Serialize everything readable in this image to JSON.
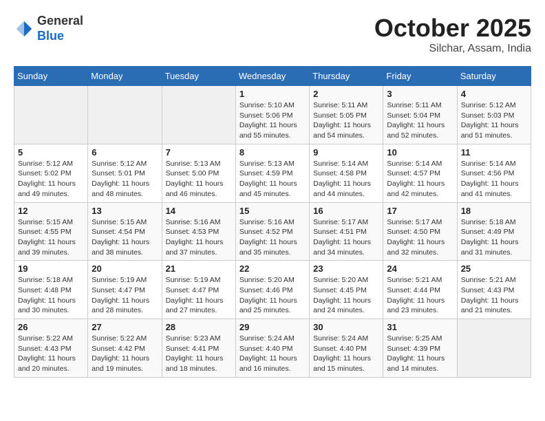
{
  "header": {
    "logo_general": "General",
    "logo_blue": "Blue",
    "month_title": "October 2025",
    "subtitle": "Silchar, Assam, India"
  },
  "weekdays": [
    "Sunday",
    "Monday",
    "Tuesday",
    "Wednesday",
    "Thursday",
    "Friday",
    "Saturday"
  ],
  "weeks": [
    [
      null,
      null,
      null,
      {
        "day": 1,
        "sunrise": "Sunrise: 5:10 AM",
        "sunset": "Sunset: 5:06 PM",
        "daylight": "Daylight: 11 hours and 55 minutes."
      },
      {
        "day": 2,
        "sunrise": "Sunrise: 5:11 AM",
        "sunset": "Sunset: 5:05 PM",
        "daylight": "Daylight: 11 hours and 54 minutes."
      },
      {
        "day": 3,
        "sunrise": "Sunrise: 5:11 AM",
        "sunset": "Sunset: 5:04 PM",
        "daylight": "Daylight: 11 hours and 52 minutes."
      },
      {
        "day": 4,
        "sunrise": "Sunrise: 5:12 AM",
        "sunset": "Sunset: 5:03 PM",
        "daylight": "Daylight: 11 hours and 51 minutes."
      }
    ],
    [
      {
        "day": 5,
        "sunrise": "Sunrise: 5:12 AM",
        "sunset": "Sunset: 5:02 PM",
        "daylight": "Daylight: 11 hours and 49 minutes."
      },
      {
        "day": 6,
        "sunrise": "Sunrise: 5:12 AM",
        "sunset": "Sunset: 5:01 PM",
        "daylight": "Daylight: 11 hours and 48 minutes."
      },
      {
        "day": 7,
        "sunrise": "Sunrise: 5:13 AM",
        "sunset": "Sunset: 5:00 PM",
        "daylight": "Daylight: 11 hours and 46 minutes."
      },
      {
        "day": 8,
        "sunrise": "Sunrise: 5:13 AM",
        "sunset": "Sunset: 4:59 PM",
        "daylight": "Daylight: 11 hours and 45 minutes."
      },
      {
        "day": 9,
        "sunrise": "Sunrise: 5:14 AM",
        "sunset": "Sunset: 4:58 PM",
        "daylight": "Daylight: 11 hours and 44 minutes."
      },
      {
        "day": 10,
        "sunrise": "Sunrise: 5:14 AM",
        "sunset": "Sunset: 4:57 PM",
        "daylight": "Daylight: 11 hours and 42 minutes."
      },
      {
        "day": 11,
        "sunrise": "Sunrise: 5:14 AM",
        "sunset": "Sunset: 4:56 PM",
        "daylight": "Daylight: 11 hours and 41 minutes."
      }
    ],
    [
      {
        "day": 12,
        "sunrise": "Sunrise: 5:15 AM",
        "sunset": "Sunset: 4:55 PM",
        "daylight": "Daylight: 11 hours and 39 minutes."
      },
      {
        "day": 13,
        "sunrise": "Sunrise: 5:15 AM",
        "sunset": "Sunset: 4:54 PM",
        "daylight": "Daylight: 11 hours and 38 minutes."
      },
      {
        "day": 14,
        "sunrise": "Sunrise: 5:16 AM",
        "sunset": "Sunset: 4:53 PM",
        "daylight": "Daylight: 11 hours and 37 minutes."
      },
      {
        "day": 15,
        "sunrise": "Sunrise: 5:16 AM",
        "sunset": "Sunset: 4:52 PM",
        "daylight": "Daylight: 11 hours and 35 minutes."
      },
      {
        "day": 16,
        "sunrise": "Sunrise: 5:17 AM",
        "sunset": "Sunset: 4:51 PM",
        "daylight": "Daylight: 11 hours and 34 minutes."
      },
      {
        "day": 17,
        "sunrise": "Sunrise: 5:17 AM",
        "sunset": "Sunset: 4:50 PM",
        "daylight": "Daylight: 11 hours and 32 minutes."
      },
      {
        "day": 18,
        "sunrise": "Sunrise: 5:18 AM",
        "sunset": "Sunset: 4:49 PM",
        "daylight": "Daylight: 11 hours and 31 minutes."
      }
    ],
    [
      {
        "day": 19,
        "sunrise": "Sunrise: 5:18 AM",
        "sunset": "Sunset: 4:48 PM",
        "daylight": "Daylight: 11 hours and 30 minutes."
      },
      {
        "day": 20,
        "sunrise": "Sunrise: 5:19 AM",
        "sunset": "Sunset: 4:47 PM",
        "daylight": "Daylight: 11 hours and 28 minutes."
      },
      {
        "day": 21,
        "sunrise": "Sunrise: 5:19 AM",
        "sunset": "Sunset: 4:47 PM",
        "daylight": "Daylight: 11 hours and 27 minutes."
      },
      {
        "day": 22,
        "sunrise": "Sunrise: 5:20 AM",
        "sunset": "Sunset: 4:46 PM",
        "daylight": "Daylight: 11 hours and 25 minutes."
      },
      {
        "day": 23,
        "sunrise": "Sunrise: 5:20 AM",
        "sunset": "Sunset: 4:45 PM",
        "daylight": "Daylight: 11 hours and 24 minutes."
      },
      {
        "day": 24,
        "sunrise": "Sunrise: 5:21 AM",
        "sunset": "Sunset: 4:44 PM",
        "daylight": "Daylight: 11 hours and 23 minutes."
      },
      {
        "day": 25,
        "sunrise": "Sunrise: 5:21 AM",
        "sunset": "Sunset: 4:43 PM",
        "daylight": "Daylight: 11 hours and 21 minutes."
      }
    ],
    [
      {
        "day": 26,
        "sunrise": "Sunrise: 5:22 AM",
        "sunset": "Sunset: 4:43 PM",
        "daylight": "Daylight: 11 hours and 20 minutes."
      },
      {
        "day": 27,
        "sunrise": "Sunrise: 5:22 AM",
        "sunset": "Sunset: 4:42 PM",
        "daylight": "Daylight: 11 hours and 19 minutes."
      },
      {
        "day": 28,
        "sunrise": "Sunrise: 5:23 AM",
        "sunset": "Sunset: 4:41 PM",
        "daylight": "Daylight: 11 hours and 18 minutes."
      },
      {
        "day": 29,
        "sunrise": "Sunrise: 5:24 AM",
        "sunset": "Sunset: 4:40 PM",
        "daylight": "Daylight: 11 hours and 16 minutes."
      },
      {
        "day": 30,
        "sunrise": "Sunrise: 5:24 AM",
        "sunset": "Sunset: 4:40 PM",
        "daylight": "Daylight: 11 hours and 15 minutes."
      },
      {
        "day": 31,
        "sunrise": "Sunrise: 5:25 AM",
        "sunset": "Sunset: 4:39 PM",
        "daylight": "Daylight: 11 hours and 14 minutes."
      },
      null
    ]
  ]
}
